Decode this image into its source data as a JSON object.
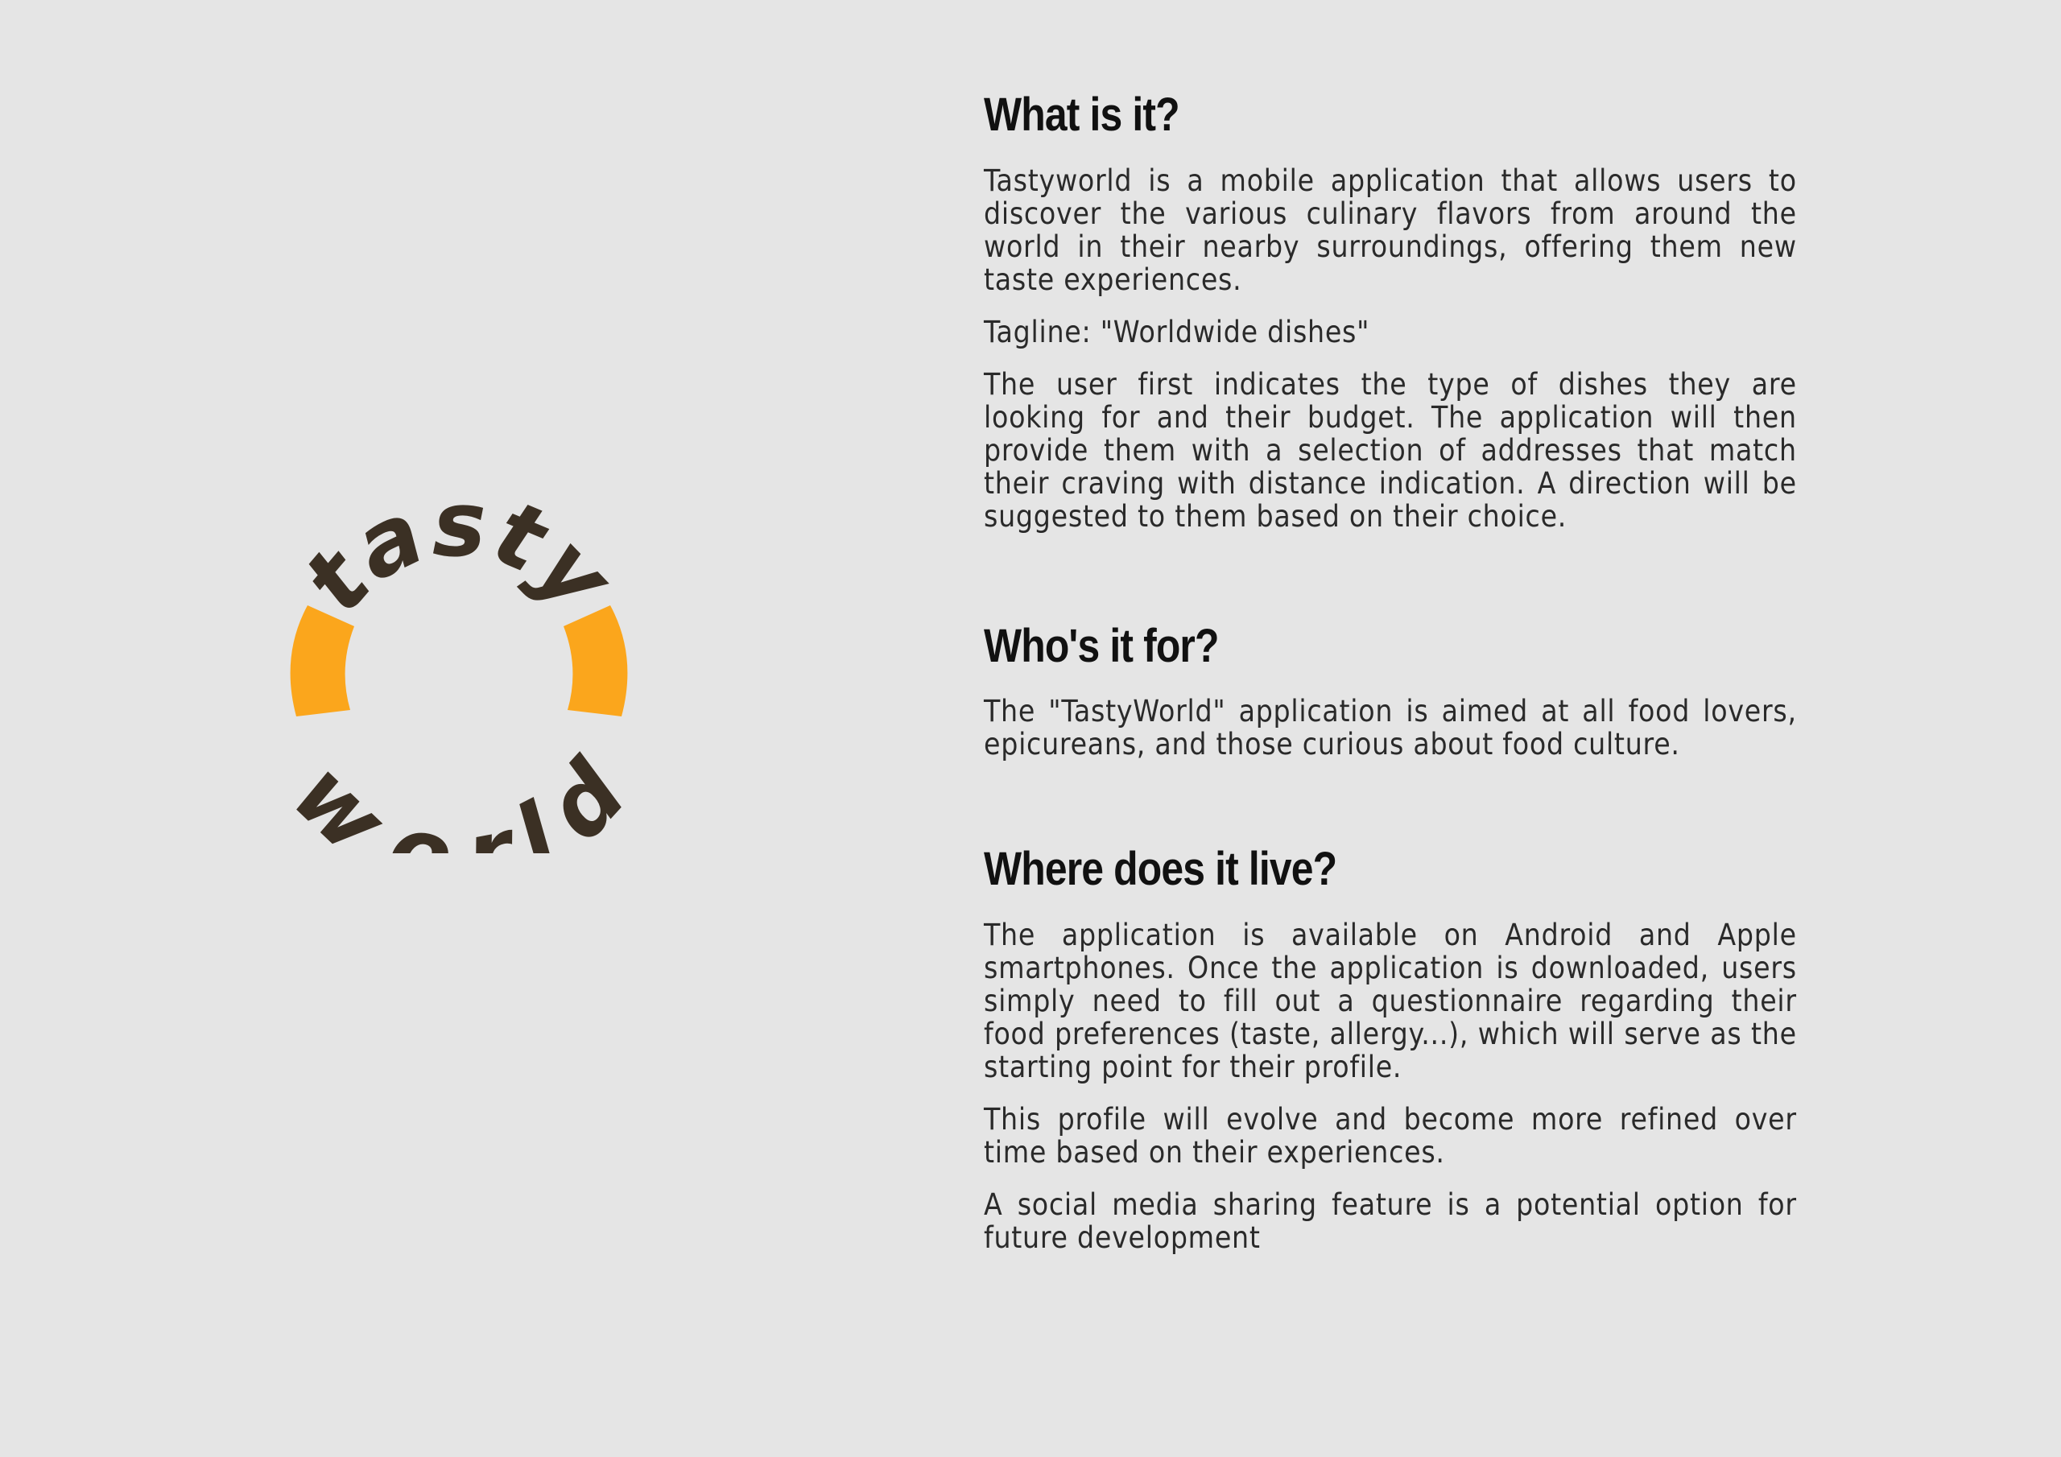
{
  "logo": {
    "top_word": "tasty",
    "bottom_word": "world",
    "colors": {
      "text": "#3b3024",
      "accent": "#fba61c"
    }
  },
  "sections": [
    {
      "title": "What is it?",
      "paragraphs": [
        "Tastyworld is a mobile application that allows users to discover the various culinary flavors from around the world in their nearby surroundings, offering them new taste experiences.",
        "Tagline: \"Worldwide dishes\"",
        "The user first indicates the type of dishes they are looking for and their budget. The application will then provide them with a selection of addresses that match their craving with distance indication. A direction will be suggested to them based on their choice."
      ]
    },
    {
      "title": "Who's it for?",
      "paragraphs": [
        "The \"TastyWorld\" application is aimed at all food lovers, epicureans, and those curious about food culture."
      ]
    },
    {
      "title": "Where does it live?",
      "paragraphs": [
        "The application is available on Android and Apple smartphones. Once the application is downloaded, users simply need to fill out a questionnaire regarding their food preferences (taste, allergy...), which will serve as the starting point for their profile.",
        "This profile will evolve and become more refined over time based on their experiences.",
        "A social media sharing feature is a potential option for future development"
      ]
    }
  ]
}
